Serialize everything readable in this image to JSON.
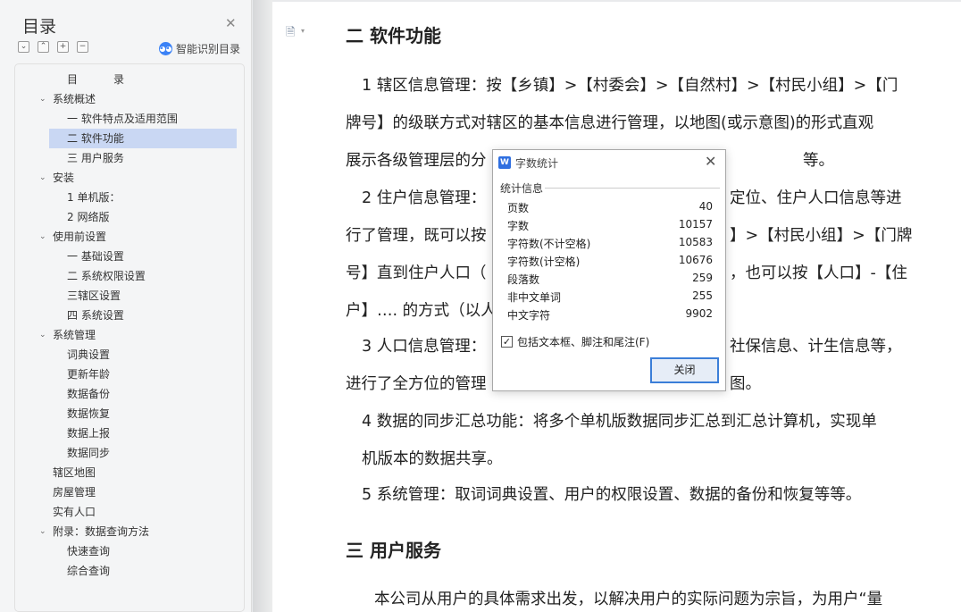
{
  "toc": {
    "title": "目录",
    "close_icon": "✕",
    "tools": [
      "⌄",
      "⌃",
      "+",
      "−"
    ],
    "smart_label": "智能识别目录",
    "items": [
      {
        "label": "目",
        "label2": "录",
        "level": "head"
      },
      {
        "label": "系统概述",
        "level": 1,
        "arrow": "⌄"
      },
      {
        "label": "一  软件特点及适用范围",
        "level": 2
      },
      {
        "label": "二  软件功能",
        "level": 2,
        "active": true
      },
      {
        "label": "三  用户服务",
        "level": 2
      },
      {
        "label": "安装",
        "level": 1,
        "arrow": "⌄"
      },
      {
        "label": "1 单机版：",
        "level": 2
      },
      {
        "label": "2  网络版",
        "level": 2
      },
      {
        "label": "使用前设置",
        "level": 1,
        "arrow": "⌄"
      },
      {
        "label": "一  基础设置",
        "level": 2
      },
      {
        "label": "二  系统权限设置",
        "level": 2
      },
      {
        "label": "三辖区设置",
        "level": 2
      },
      {
        "label": "四  系统设置",
        "level": 2
      },
      {
        "label": "系统管理",
        "level": 1,
        "arrow": "⌄"
      },
      {
        "label": "词典设置",
        "level": 2
      },
      {
        "label": "更新年龄",
        "level": 2
      },
      {
        "label": "数据备份",
        "level": 2
      },
      {
        "label": "数据恢复",
        "level": 2
      },
      {
        "label": "数据上报",
        "level": 2
      },
      {
        "label": "数据同步",
        "level": 2
      },
      {
        "label": "辖区地图",
        "level": 0
      },
      {
        "label": "房屋管理",
        "level": 0
      },
      {
        "label": "实有人口",
        "level": 0
      },
      {
        "label": "附录：数据查询方法",
        "level": 1,
        "arrow": "⌄"
      },
      {
        "label": "快速查询",
        "level": 2
      },
      {
        "label": "综合查询",
        "level": 2
      }
    ]
  },
  "doc": {
    "heading2": "二  软件功能",
    "p1": [
      "1  辖区信息管理：按【乡镇】>【村委会】>【自然村】>【村民小组】>【门",
      "牌号】的级联方式对辖区的基本信息进行管理，以地图(或示意图)的形式直观",
      "展示各级管理层的分"
    ],
    "p1_tail": "等。",
    "p2": [
      "2  住户信息管理：",
      "行了管理，既可以按",
      "号】直到住户人口（",
      "户】…. 的方式（以人"
    ],
    "p2_tail": [
      "定位、住户人口信息等进",
      "】>【村民小组】>【门牌",
      "，也可以按【人口】-【住"
    ],
    "p3": [
      "3  人口信息管理：",
      "进行了全方位的管理"
    ],
    "p3_tail": [
      "社保信息、计生信息等，",
      "图。"
    ],
    "p4": [
      "4  数据的同步汇总功能：将多个单机版数据同步汇总到汇总计算机，实现单",
      "机版本的数据共享。"
    ],
    "p5": "5  系统管理：取词词典设置、用户的权限设置、数据的备份和恢复等等。",
    "heading3": "三  用户服务",
    "p6": "本公司从用户的具体需求出发，以解决用户的实际问题为宗旨，为用户“量"
  },
  "dialog": {
    "title": "字数统计",
    "section": "统计信息",
    "stats": [
      {
        "label": "页数",
        "value": "40"
      },
      {
        "label": "字数",
        "value": "10157"
      },
      {
        "label": "字符数(不计空格)",
        "value": "10583"
      },
      {
        "label": "字符数(计空格)",
        "value": "10676"
      },
      {
        "label": "段落数",
        "value": "259"
      },
      {
        "label": "非中文单词",
        "value": "255"
      },
      {
        "label": "中文字符",
        "value": "9902"
      }
    ],
    "checkbox_label": "包括文本框、脚注和尾注(F)",
    "checkbox_checked": true,
    "close_button": "关闭"
  }
}
